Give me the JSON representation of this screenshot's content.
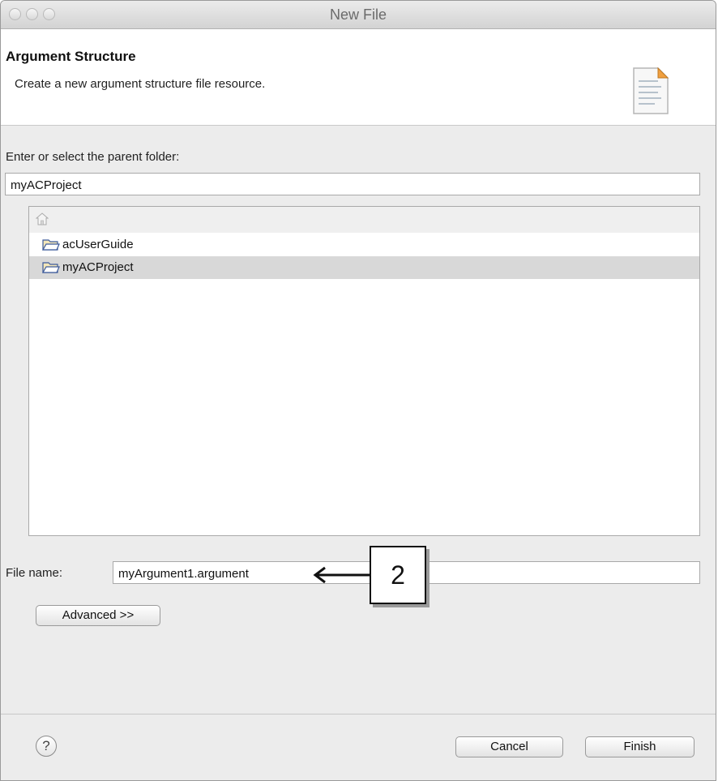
{
  "window": {
    "title": "New File"
  },
  "header": {
    "title": "Argument Structure",
    "description": "Create a new argument structure file resource."
  },
  "parent_folder": {
    "label": "Enter or select the parent folder:",
    "value": "myACProject"
  },
  "tree": {
    "items": [
      {
        "label": "acUserGuide",
        "icon": "folder-icon",
        "selected": false
      },
      {
        "label": "myACProject",
        "icon": "folder-icon",
        "selected": true
      }
    ]
  },
  "file_name": {
    "label": "File name:",
    "value": "myArgument1.argument"
  },
  "advanced_button": {
    "label": "Advanced >>"
  },
  "callout": {
    "number": "2"
  },
  "buttons": {
    "cancel": "Cancel",
    "finish": "Finish"
  },
  "help": {
    "symbol": "?"
  }
}
